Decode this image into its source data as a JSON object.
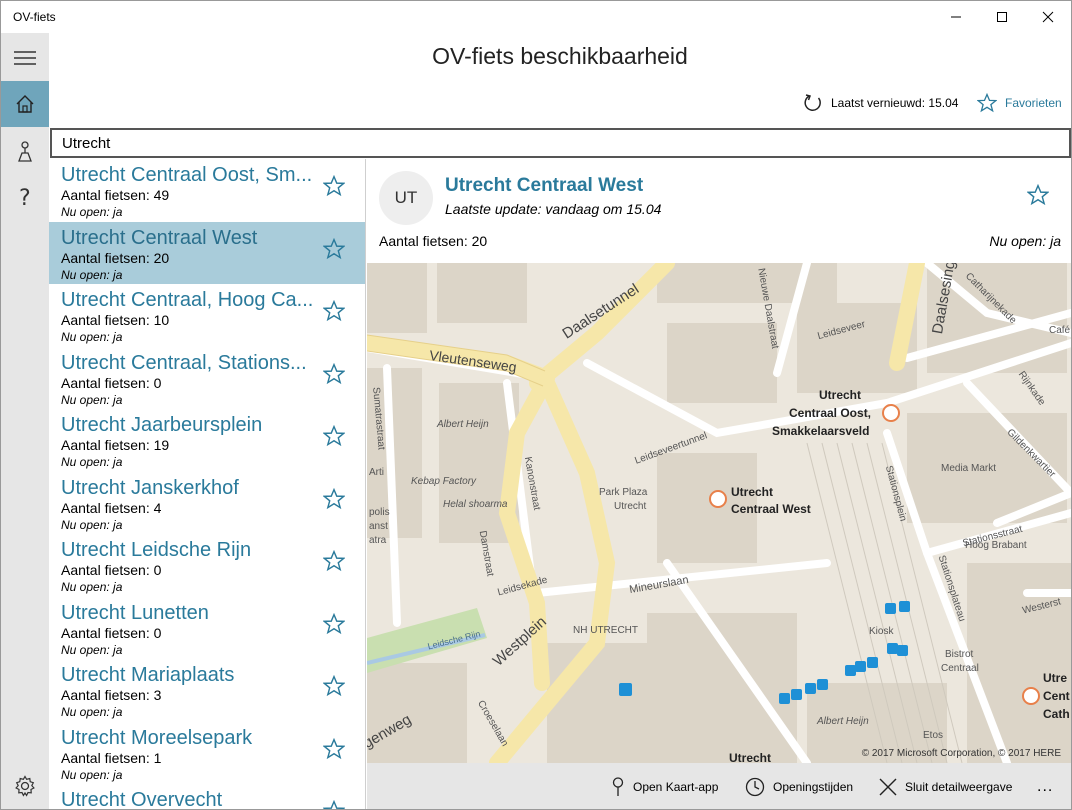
{
  "window": {
    "app_title": "OV-fiets"
  },
  "header": {
    "title": "OV-fiets beschikbaarheid",
    "refresh_label": "Laatst vernieuwd: 15.04",
    "favorites_label": "Favorieten"
  },
  "search": {
    "value": "Utrecht"
  },
  "stations": [
    {
      "name": "Utrecht Centraal Oost, Sm...",
      "count": "Aantal fietsen: 49",
      "open": "Nu open: ja"
    },
    {
      "name": "Utrecht Centraal West",
      "count": "Aantal fietsen: 20",
      "open": "Nu open: ja"
    },
    {
      "name": "Utrecht Centraal, Hoog Ca...",
      "count": "Aantal fietsen: 10",
      "open": "Nu open: ja"
    },
    {
      "name": "Utrecht Centraal, Stations...",
      "count": "Aantal fietsen: 0",
      "open": "Nu open: ja"
    },
    {
      "name": "Utrecht Jaarbeursplein",
      "count": "Aantal fietsen: 19",
      "open": "Nu open: ja"
    },
    {
      "name": "Utrecht Janskerkhof",
      "count": "Aantal fietsen: 4",
      "open": "Nu open: ja"
    },
    {
      "name": "Utrecht Leidsche Rijn",
      "count": "Aantal fietsen: 0",
      "open": "Nu open: ja"
    },
    {
      "name": "Utrecht Lunetten",
      "count": "Aantal fietsen: 0",
      "open": "Nu open: ja"
    },
    {
      "name": "Utrecht Mariaplaats",
      "count": "Aantal fietsen: 3",
      "open": "Nu open: ja"
    },
    {
      "name": "Utrecht Moreelsepark",
      "count": "Aantal fietsen: 1",
      "open": "Nu open: ja"
    },
    {
      "name": "Utrecht Overvecht",
      "count": "",
      "open": ""
    }
  ],
  "detail": {
    "initials": "UT",
    "title": "Utrecht Centraal West",
    "update": "Laatste update: vandaag om 15.04",
    "count": "Aantal fietsen: 20",
    "open": "Nu open: ja"
  },
  "map": {
    "copyright": "© 2017 Microsoft Corporation, © 2017 HERE",
    "streets": {
      "daalsetunnel": "Daalsetunnel",
      "vleutenseweg": "Vleutenseweg",
      "daalsesingel": "Daalsesingel",
      "nieuwe_daalstraat": "Nieuwe Daalstraat",
      "leidseveer": "Leidseveer",
      "sumatrastraat": "Sumatrastraat",
      "leidseveertunnel": "Leidseveertunnel",
      "kanonstraat": "Kanonstraat",
      "stationsplein": "Stationsplein",
      "damstraat": "Damstraat",
      "leidsekade": "Leidsekade",
      "mineurslaan": "Mineurslaan",
      "westplein": "Westplein",
      "leidsche_rijn": "Leidsche Rijn",
      "croeselaan": "Croeselaan",
      "stationsplateau": "Stationsplateau",
      "stationsstraat": "Stationsstraat",
      "rijnkade": "Rijnkade",
      "gildenkwartier": "Gildenkwartier",
      "westerstr": "Westerst",
      "catharijnekade": "Catharijnekade",
      "genweg": "genweg",
      "arti": "Arti",
      "polis": "polis",
      "anst": "anst",
      "atra": "atra"
    },
    "pois": {
      "albert_heijn": "Albert Heijn",
      "albert_heijn_2": "Albert Heijn",
      "kebap_factory": "Kebap Factory",
      "helal_shoarma": "Helal shoarma",
      "park_plaza": "Park Plaza",
      "park_plaza_2": "Utrecht",
      "media_markt": "Media Markt",
      "hoog_brabant": "Hoog Brabant",
      "nh_utrecht": "NH UTRECHT",
      "kiosk": "Kiosk",
      "bistrot": "Bistrot",
      "bistrot_2": "Centraal",
      "etos": "Etos",
      "cafe": "Café"
    },
    "markers": {
      "oost_line1": "Utrecht",
      "oost_line2": "Centraal Oost,",
      "oost_line3": "Smakkelaarsveld",
      "west_line1": "Utrecht",
      "west_line2": "Centraal West",
      "right_line1": "Utre",
      "right_line2": "Cent",
      "right_line3": "Cath",
      "bottom": "Utrecht"
    }
  },
  "commands": {
    "open_map": "Open Kaart-app",
    "hours": "Openingstijden",
    "close_detail": "Sluit detailweergave",
    "more": "..."
  },
  "colors": {
    "accent": "#2a7a9b",
    "selected": "#a9ccda",
    "rail_active": "#6fa5bb"
  }
}
